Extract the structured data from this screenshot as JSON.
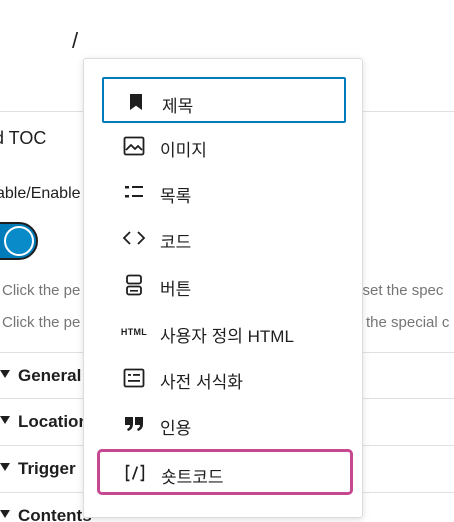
{
  "editor": {
    "slash_text": "/",
    "panel_title": "d TOC",
    "enable_label": "able/Enable",
    "help_lines": [
      {
        "left": "Click the pe",
        "right": "n set the spec"
      },
      {
        "left": "Click the pe",
        "right": "the special c"
      }
    ],
    "sections": [
      "General",
      "Location",
      "Trigger",
      "Contents"
    ]
  },
  "inserter": {
    "items": [
      {
        "icon": "bookmark-icon",
        "label": "제목",
        "state": "selected"
      },
      {
        "icon": "image-icon",
        "label": "이미지",
        "state": "default"
      },
      {
        "icon": "list-icon",
        "label": "목록",
        "state": "default"
      },
      {
        "icon": "code-icon",
        "label": "코드",
        "state": "default"
      },
      {
        "icon": "button-icon",
        "label": "버튼",
        "state": "default"
      },
      {
        "icon": "html-icon",
        "icon_text": "HTML",
        "label": "사용자 정의 HTML",
        "state": "default"
      },
      {
        "icon": "classic-icon",
        "label": "사전 서식화",
        "state": "default"
      },
      {
        "icon": "quote-icon",
        "label": "인용",
        "state": "default"
      },
      {
        "icon": "shortcode-icon",
        "icon_text": "[/]",
        "label": "숏트코드",
        "state": "highlighted"
      }
    ]
  },
  "colors": {
    "selected_border": "#007cba",
    "highlight_border": "#c6488f",
    "toggle_on": "#007cba",
    "help_text": "#757575"
  }
}
